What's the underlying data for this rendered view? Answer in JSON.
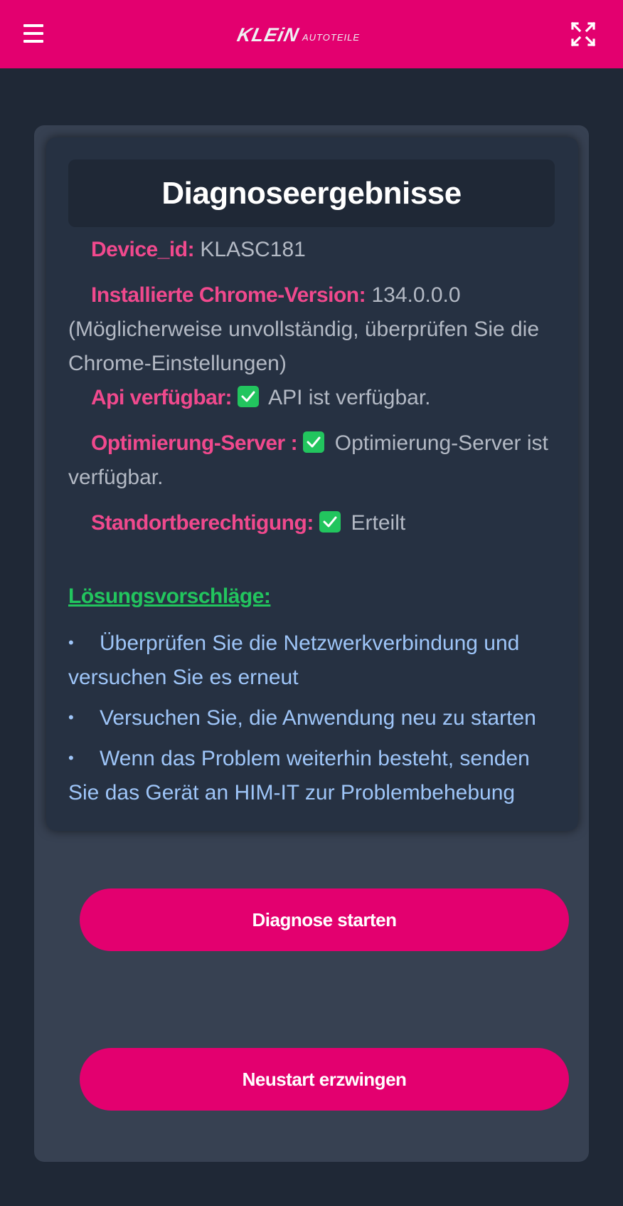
{
  "header": {
    "logo_main": "KLEiN",
    "logo_sub": "AUTOTEILE",
    "menu_icon": "hamburger-menu-icon",
    "fullscreen_icon": "fullscreen-icon",
    "background_color": "#e3006f"
  },
  "card": {
    "title": "Diagnoseergebnisse",
    "fields": [
      {
        "label": "Device_id:",
        "value": "KLASC181",
        "status": null
      },
      {
        "label": "Installierte Chrome-Version:",
        "value": "134.0.0.0 (Möglicherweise unvollständig, überprüfen Sie die Chrome-Einstellungen)",
        "status": null
      },
      {
        "label": "Api verfügbar:",
        "value": "API ist verfügbar.",
        "status": "ok"
      },
      {
        "label": "Optimierung-Server :",
        "value": "Optimierung-Server ist verfügbar.",
        "status": "ok"
      },
      {
        "label": "Standortberechtigung:",
        "value": "Erteilt",
        "status": "ok"
      }
    ],
    "solutions_heading": "Lösungsvorschläge:",
    "solutions": [
      "Überprüfen Sie die Netzwerkverbindung und versuchen Sie es erneut",
      "Versuchen Sie, die Anwendung neu zu starten",
      "Wenn das Problem weiterhin besteht, senden Sie das Gerät an HIM-IT zur Problembehebung"
    ],
    "bullet": "•"
  },
  "buttons": {
    "start_diagnosis": "Diagnose starten",
    "force_restart": "Neustart erzwingen"
  },
  "colors": {
    "accent": "#e3006f",
    "label": "#f0498d",
    "success": "#22c55e",
    "solution_text": "#9ec5f8"
  }
}
